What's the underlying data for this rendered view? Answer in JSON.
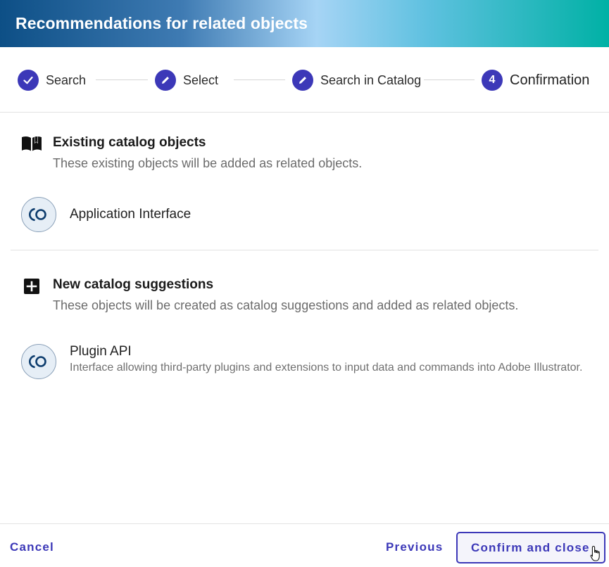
{
  "dialog": {
    "title": "Recommendations for related objects"
  },
  "stepper": {
    "steps": [
      {
        "label": "Search",
        "state": "completed",
        "icon": "check-icon"
      },
      {
        "label": "Select",
        "state": "edit",
        "icon": "pencil-icon"
      },
      {
        "label": "Search in Catalog",
        "state": "edit",
        "icon": "pencil-icon"
      },
      {
        "label": "Confirmation",
        "state": "active",
        "number": "4"
      }
    ]
  },
  "existing": {
    "icon": "open-book-icon",
    "title": "Existing catalog objects",
    "description": "These existing objects will be added as related objects.",
    "items": [
      {
        "name": "Application Interface",
        "icon": "interface-icon"
      }
    ]
  },
  "suggestions": {
    "icon": "plus-box-icon",
    "title": "New catalog suggestions",
    "description": "These objects will be created as catalog suggestions and added as related objects.",
    "items": [
      {
        "name": "Plugin API",
        "description": "Interface allowing third-party plugins and extensions to input data and commands into Adobe Illustrator.",
        "icon": "interface-icon"
      }
    ]
  },
  "footer": {
    "cancel_label": "Cancel",
    "previous_label": "Previous",
    "confirm_label": "Confirm and close"
  },
  "colors": {
    "accent": "#3c38b8",
    "header_start": "#0d4f86",
    "header_end": "#00b1a5"
  }
}
